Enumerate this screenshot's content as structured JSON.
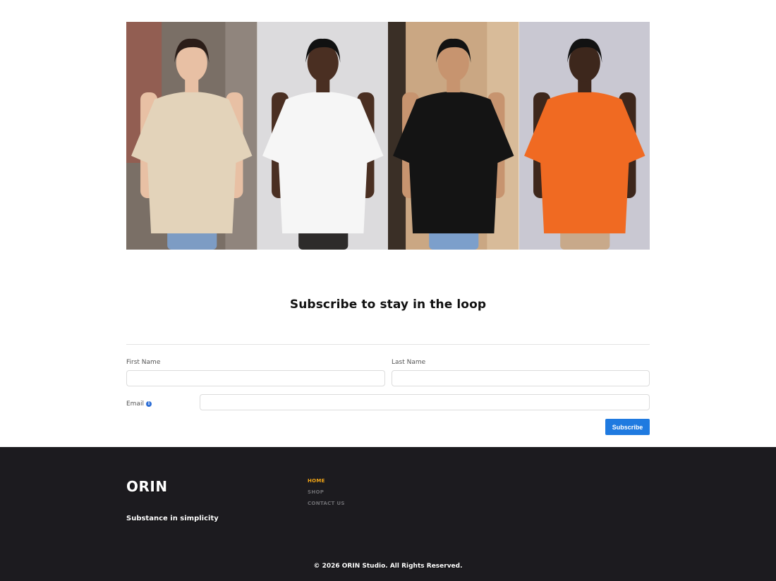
{
  "gallery": {
    "images": [
      {
        "name": "model-beige-tee",
        "shirt_color": "#e3d3ba",
        "pants_color": "#7d9cc4",
        "bg_color": "#7a6f66",
        "skin": "#e8c0a4",
        "hair": "#2b1d18"
      },
      {
        "name": "model-white-tee",
        "shirt_color": "#f6f6f6",
        "pants_color": "#2d2b2a",
        "bg_color": "#dcdbdd",
        "skin": "#4a2f22",
        "hair": "#111111"
      },
      {
        "name": "model-black-tee",
        "shirt_color": "#141414",
        "pants_color": "#7c9fcb",
        "bg_color": "#caa783",
        "skin": "#c7946f",
        "hair": "#121212"
      },
      {
        "name": "model-orange-tee",
        "shirt_color": "#f06a22",
        "pants_color": "#c8a98a",
        "bg_color": "#c9c8d2",
        "skin": "#3d271c",
        "hair": "#121212"
      }
    ]
  },
  "subscribe": {
    "title": "Subscribe to stay in the loop",
    "first_name_label": "First Name",
    "last_name_label": "Last Name",
    "email_label": "Email",
    "first_name_value": "",
    "last_name_value": "",
    "email_value": "",
    "button_label": "Subscribe",
    "accent": "#1f7ae0"
  },
  "footer": {
    "brand": "ORIN",
    "tagline": "Substance in simplicity",
    "nav": [
      {
        "label": "HOME",
        "active": true
      },
      {
        "label": "SHOP",
        "active": false
      },
      {
        "label": "CONTACT US",
        "active": false
      }
    ],
    "copyright": "© 2026 ORIN Studio. All Rights Reserved.",
    "active_color": "#f2a516",
    "bg_color": "#1c1b1f"
  }
}
